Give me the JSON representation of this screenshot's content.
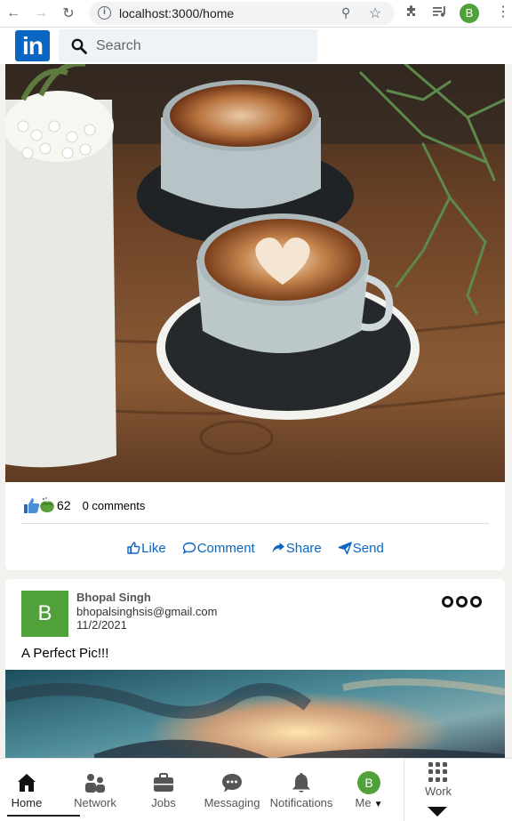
{
  "browser": {
    "url": "localhost:3000/home",
    "profile_initial": "B"
  },
  "header": {
    "logo_text": "in",
    "search_placeholder": "Search"
  },
  "posts": [
    {
      "image": "coffee-latte-art-photo",
      "likes": "62",
      "comments": "0 comments",
      "actions": [
        "Like",
        "Comment",
        "Share",
        "Send"
      ]
    },
    {
      "author_initial": "B",
      "author_name": "Bhopal Singh",
      "author_email": "bhopalsinghsis@gmail.com",
      "date": "11/2/2021",
      "caption": "A Perfect Pic!!!",
      "image": "sunset-sky-photo"
    }
  ],
  "bottom_nav": {
    "items": [
      "Home",
      "Network",
      "Jobs",
      "Messaging",
      "Notifications",
      "Me"
    ],
    "me_initial": "B",
    "work_label": "Work",
    "active": "Home"
  },
  "colors": {
    "brand": "#0a66c2",
    "avatar_green": "#51a13a",
    "page_bg": "#f3f2ef"
  }
}
